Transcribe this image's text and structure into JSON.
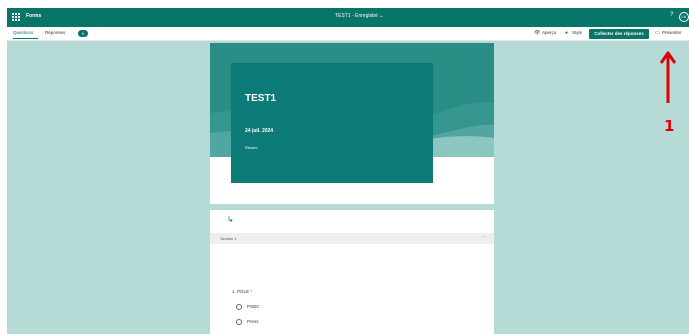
{
  "app": {
    "name": "Forms",
    "doc_title": "TEST1 - Enregistré ⌄",
    "help": "?",
    "avatar": "LK"
  },
  "tabs": [
    {
      "label": "Questions"
    },
    {
      "label": "Réponses"
    }
  ],
  "responses_count": "0",
  "toolbar": {
    "preview_icon": "eye-icon",
    "preview_label": "Aperçu",
    "style_icon": "palette-icon",
    "style_label": "Style",
    "collect_label": "Collecter des réponses",
    "present_icon": "monitor-icon",
    "present_label": "Présenter",
    "more_label": "···"
  },
  "form": {
    "title": "TEST1",
    "date": "24 juil. 2024",
    "subtitle": "Résum",
    "section_icon": "section-icon",
    "section_label": "Section 1",
    "section_more": "···",
    "question": {
      "number_label": "1. POLE",
      "required_mark": "*",
      "options": [
        "PSDC",
        "Press"
      ]
    }
  },
  "colors": {
    "accent": "#077568",
    "canvas": "#b6dbd6",
    "title_panel": "#0c7b77",
    "annotation": "#e00000"
  },
  "annotation": {
    "label": "1"
  }
}
